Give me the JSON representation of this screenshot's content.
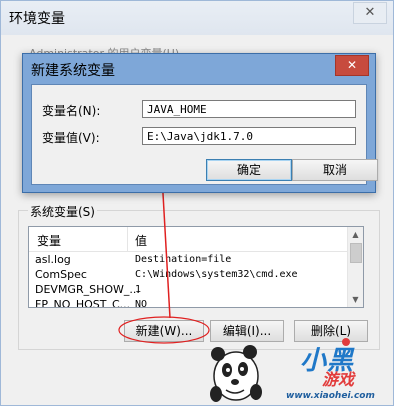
{
  "env_window": {
    "title": "环境变量",
    "close_glyph": "✕",
    "user_vars_label": "Administrator 的用户变量(U)"
  },
  "system_vars": {
    "label": "系统变量(S)",
    "columns": [
      "变量",
      "值"
    ],
    "rows": [
      {
        "name": "asl.log",
        "value": "Destination=file"
      },
      {
        "name": "ComSpec",
        "value": "C:\\Windows\\system32\\cmd.exe"
      },
      {
        "name": "DEVMGR_SHOW_...",
        "value": "1"
      },
      {
        "name": "FP_NO_HOST_C...",
        "value": "NO"
      }
    ],
    "buttons": {
      "new": "新建(W)...",
      "edit": "编辑(I)...",
      "delete": "删除(L)"
    }
  },
  "dialog": {
    "title": "新建系统变量",
    "close_glyph": "✕",
    "name_label": "变量名(N):",
    "name_value": "JAVA_HOME",
    "value_label": "变量值(V):",
    "value_value": "E:\\Java\\jdk1.7.0",
    "ok": "确定",
    "cancel": "取消"
  },
  "watermark": {
    "brand": "小黑",
    "sub": "游戏",
    "url": "www.xiaohei.com"
  },
  "colors": {
    "dialog_frame": "#7ea7d8",
    "close_red": "#c74b3e",
    "annotation_red": "#e02020",
    "watermark_blue": "#1f78c8"
  }
}
